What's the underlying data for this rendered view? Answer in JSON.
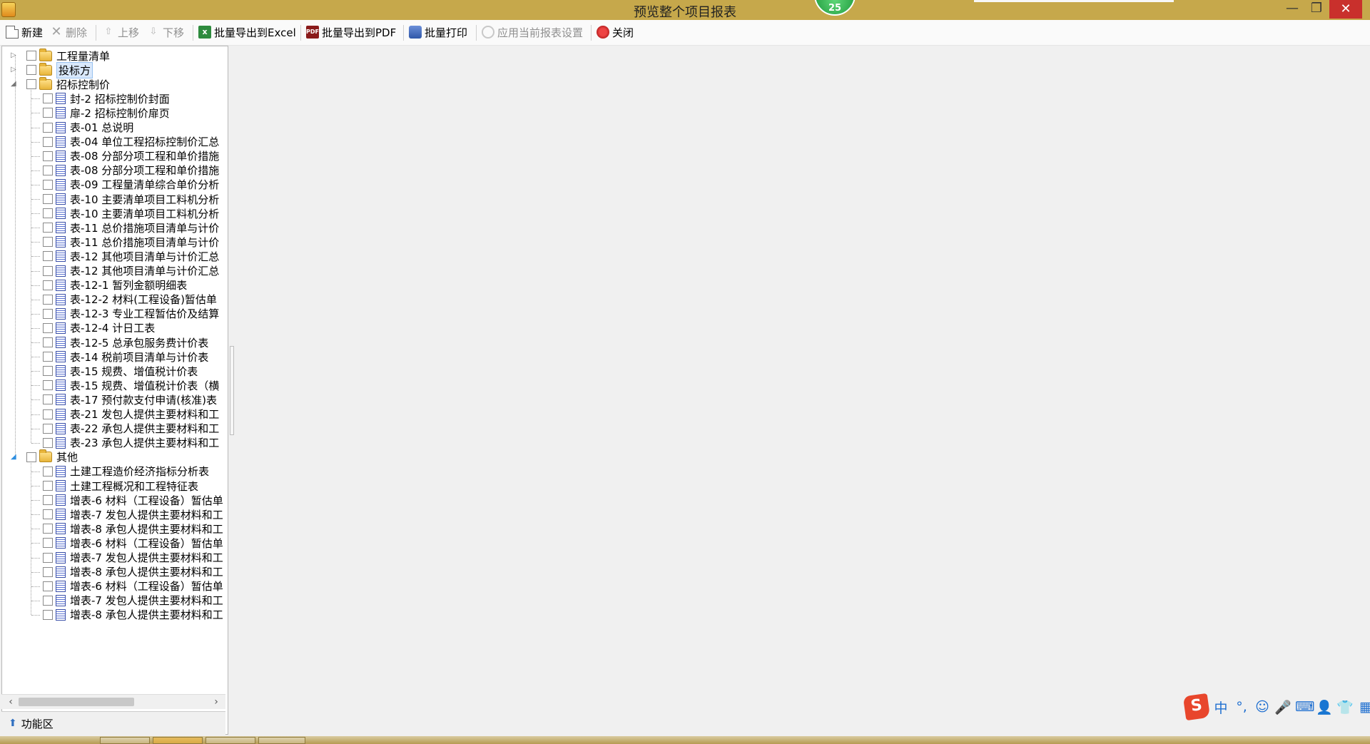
{
  "window": {
    "title": "预览整个项目报表",
    "badge": "25",
    "minimize": "—",
    "maximize": "❐",
    "close": "✕"
  },
  "toolbar": {
    "new": "新建",
    "delete": "删除",
    "move_up": "上移",
    "move_down": "下移",
    "export_excel": "批量导出到Excel",
    "export_pdf": "批量导出到PDF",
    "batch_print": "批量打印",
    "apply_settings": "应用当前报表设置",
    "close": "关闭"
  },
  "tree": {
    "groups": [
      {
        "label": "工程量清单",
        "expanded": false,
        "selected": false,
        "items": []
      },
      {
        "label": "投标方",
        "expanded": false,
        "selected": true,
        "items": []
      },
      {
        "label": "招标控制价",
        "expanded": true,
        "selected": false,
        "items": [
          "封-2 招标控制价封面",
          "扉-2 招标控制价扉页",
          "表-01 总说明",
          "表-04 单位工程招标控制价汇总",
          "表-08 分部分项工程和单价措施",
          "表-08 分部分项工程和单价措施",
          "表-09 工程量清单综合单价分析",
          "表-10 主要清单项目工料机分析",
          "表-10 主要清单项目工料机分析",
          "表-11 总价措施项目清单与计价",
          "表-11 总价措施项目清单与计价",
          "表-12 其他项目清单与计价汇总",
          "表-12 其他项目清单与计价汇总",
          "表-12-1 暂列金额明细表",
          "表-12-2 材料(工程设备)暂估单",
          "表-12-3 专业工程暂估价及结算",
          "表-12-4 计日工表",
          "表-12-5 总承包服务费计价表",
          "表-14 税前项目清单与计价表",
          "表-15 规费、增值税计价表",
          "表-15 规费、增值税计价表（横",
          "表-17 预付款支付申请(核准)表",
          "表-21 发包人提供主要材料和工",
          "表-22 承包人提供主要材料和工",
          "表-23 承包人提供主要材料和工"
        ]
      },
      {
        "label": "其他",
        "expanded": true,
        "selected": false,
        "items": [
          "土建工程造价经济指标分析表",
          "土建工程概况和工程特征表",
          "增表-6 材料（工程设备）暂估单",
          "增表-7 发包人提供主要材料和工",
          "增表-8 承包人提供主要材料和工",
          "增表-6 材料（工程设备）暂估单",
          "增表-7 发包人提供主要材料和工",
          "增表-8 承包人提供主要材料和工",
          "增表-6 材料（工程设备）暂估单",
          "增表-7 发包人提供主要材料和工",
          "增表-8 承包人提供主要材料和工"
        ]
      }
    ]
  },
  "footer": {
    "function_area": "功能区"
  },
  "ime": {
    "logo": "S",
    "chinese_mode": "中",
    "punct": "°,",
    "emoji": "☺",
    "mic": "🎤",
    "keyboard": "⌨",
    "user": "👤",
    "skin": "👕",
    "menu": "▦"
  },
  "colors": {
    "titlebar": "#c6a84b",
    "close_button": "#c9302c",
    "selection": "#d9e8fb"
  }
}
